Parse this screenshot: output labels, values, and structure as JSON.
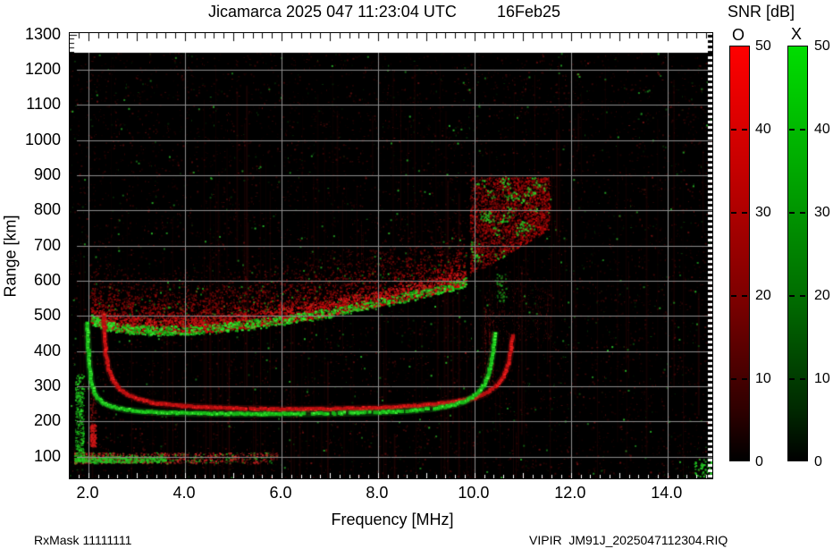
{
  "title": {
    "main": "Jicamarca 2025 047 11:23:04 UTC",
    "date": "16Feb25"
  },
  "footer": {
    "left": "RxMask 11111111",
    "right": "VIPIR  JM91J_2025047112304.RIQ"
  },
  "axes": {
    "xlabel": "Frequency [MHz]",
    "ylabel": "Range [km]"
  },
  "colorbar": {
    "title": "SNR [dB]",
    "o_label": "O",
    "x_label": "X",
    "range": [
      0,
      50
    ],
    "tick_labels": [
      "50",
      "40",
      "30",
      "20",
      "10",
      "0"
    ],
    "o_top_color": "#ff0000",
    "x_top_color": "#00dd00"
  },
  "chart_data": {
    "type": "heatmap",
    "subtype": "ionogram",
    "title": "Jicamarca 2025 047 11:23:04 UTC   16Feb25",
    "xlabel": "Frequency [MHz]",
    "ylabel": "Range [km]",
    "xlim": [
      1.61,
      14.93
    ],
    "ylim": [
      37,
      1300
    ],
    "data_region_top_km": 1245,
    "grid": true,
    "grid_color": "#8d8d8d",
    "x_tick_values": [
      2,
      4,
      6,
      8,
      10,
      12,
      14
    ],
    "x_tick_labels": [
      "2.0",
      "4.0",
      "6.0",
      "8.0",
      "10.0",
      "12.0",
      "14.0"
    ],
    "y_tick_values": [
      100,
      200,
      300,
      400,
      500,
      600,
      700,
      800,
      900,
      1000,
      1100,
      1200,
      1300
    ],
    "y_tick_labels": [
      "100",
      "200",
      "300",
      "400",
      "500",
      "600",
      "700",
      "800",
      "900",
      "1000",
      "1100",
      "1200",
      "1300"
    ],
    "minor_x_tick_step_mhz": 0.2,
    "minor_y_tick_step_km": 12.5,
    "snr_range_db": [
      0,
      50
    ],
    "series": [
      {
        "name": "X-mode F-region trace",
        "mode": "X",
        "color": "#1ecf1e",
        "points": [
          [
            1.97,
            480
          ],
          [
            1.99,
            420
          ],
          [
            2.02,
            355
          ],
          [
            2.06,
            310
          ],
          [
            2.12,
            283
          ],
          [
            2.2,
            264
          ],
          [
            2.32,
            251
          ],
          [
            2.5,
            241
          ],
          [
            2.75,
            233
          ],
          [
            3.1,
            228
          ],
          [
            3.6,
            224
          ],
          [
            4.2,
            222
          ],
          [
            5.0,
            221
          ],
          [
            6.0,
            221
          ],
          [
            7.0,
            222
          ],
          [
            8.0,
            225
          ],
          [
            8.7,
            230
          ],
          [
            9.2,
            237
          ],
          [
            9.6,
            247
          ],
          [
            9.85,
            259
          ],
          [
            10.05,
            277
          ],
          [
            10.2,
            303
          ],
          [
            10.3,
            338
          ],
          [
            10.37,
            385
          ],
          [
            10.41,
            430
          ],
          [
            10.43,
            455
          ]
        ],
        "gaps": [
          [
            6.3,
            7.05,
            0.5
          ],
          [
            7.05,
            8.05,
            0.28
          ],
          [
            8.3,
            9.25,
            0.3
          ]
        ]
      },
      {
        "name": "O-mode F-region trace",
        "mode": "O",
        "color": "#e01414",
        "points": [
          [
            2.31,
            500
          ],
          [
            2.33,
            445
          ],
          [
            2.36,
            390
          ],
          [
            2.42,
            345
          ],
          [
            2.52,
            312
          ],
          [
            2.65,
            291
          ],
          [
            2.82,
            275
          ],
          [
            3.05,
            262
          ],
          [
            3.35,
            252
          ],
          [
            3.8,
            245
          ],
          [
            4.5,
            239
          ],
          [
            5.2,
            236
          ],
          [
            6.0,
            234
          ],
          [
            7.0,
            235
          ],
          [
            8.0,
            238
          ],
          [
            8.7,
            243
          ],
          [
            9.2,
            249
          ],
          [
            9.7,
            258
          ],
          [
            10.0,
            266
          ],
          [
            10.25,
            280
          ],
          [
            10.45,
            300
          ],
          [
            10.6,
            327
          ],
          [
            10.7,
            362
          ],
          [
            10.76,
            405
          ],
          [
            10.79,
            448
          ]
        ],
        "gaps": [
          [
            4.6,
            5.4,
            0.12
          ]
        ]
      },
      {
        "name": "spread-F band lower edge",
        "mode": "mixed",
        "color": "#2bd42b",
        "points": [
          [
            2.05,
            482
          ],
          [
            2.3,
            465
          ],
          [
            2.7,
            455
          ],
          [
            3.3,
            450
          ],
          [
            4.0,
            451
          ],
          [
            4.7,
            457
          ],
          [
            5.4,
            468
          ],
          [
            6.0,
            479
          ],
          [
            6.6,
            492
          ],
          [
            7.2,
            507
          ],
          [
            7.8,
            523
          ],
          [
            8.4,
            540
          ],
          [
            9.0,
            558
          ],
          [
            9.5,
            575
          ],
          [
            9.8,
            588
          ]
        ]
      }
    ],
    "regions": [
      {
        "name": "spread-F diffuse cloud",
        "f_range": [
          2.05,
          9.8
        ],
        "km_above_edge": [
          0,
          200
        ],
        "color": "red-speckle"
      },
      {
        "name": "upper-right patch",
        "f_range": [
          9.9,
          11.55
        ],
        "km_range": [
          615,
          895
        ],
        "color": "red-speckle-green-clumps"
      },
      {
        "name": "below-patch scatter",
        "f_range": [
          10.2,
          11.6
        ],
        "km_range": [
          430,
          610
        ],
        "color": "dim-red"
      },
      {
        "name": "E-region scatter",
        "f_range": [
          1.7,
          5.9
        ],
        "km_range": [
          82,
          112
        ],
        "color": "red-green-speckle"
      },
      {
        "name": "left green streak",
        "f_range": [
          1.72,
          1.9
        ],
        "km_range": [
          88,
          335
        ],
        "color": "green"
      },
      {
        "name": "low red streak",
        "f_range": [
          2.03,
          2.14
        ],
        "km_range": [
          130,
          300
        ],
        "color": "red"
      },
      {
        "name": "asymptote red streaks",
        "f_values": [
          10.22,
          10.3,
          10.38
        ],
        "km_range": [
          300,
          520
        ],
        "color": "dim-red"
      },
      {
        "name": "bottom-right green clump",
        "f_range": [
          14.55,
          14.93
        ],
        "km_range": [
          45,
          95
        ],
        "color": "green"
      }
    ],
    "noise": {
      "background_speckles": 8500,
      "background_green_fraction": 0.08,
      "rfi_stripes": 150,
      "bright_green_dots": 230,
      "spread_f_speckles": 5200,
      "spread_f_rim_speckles": 1600,
      "spread_f_green_edge_speckles": 950,
      "upper_patch_speckles": 2600,
      "upper_patch_green_clusters": 28,
      "e_region_speckles": 1150,
      "e_region_green_speckles": 320,
      "left_green_streak_speckles": 430,
      "red_streak_speckles": 240,
      "bottom_right_green_speckles": 60
    }
  }
}
